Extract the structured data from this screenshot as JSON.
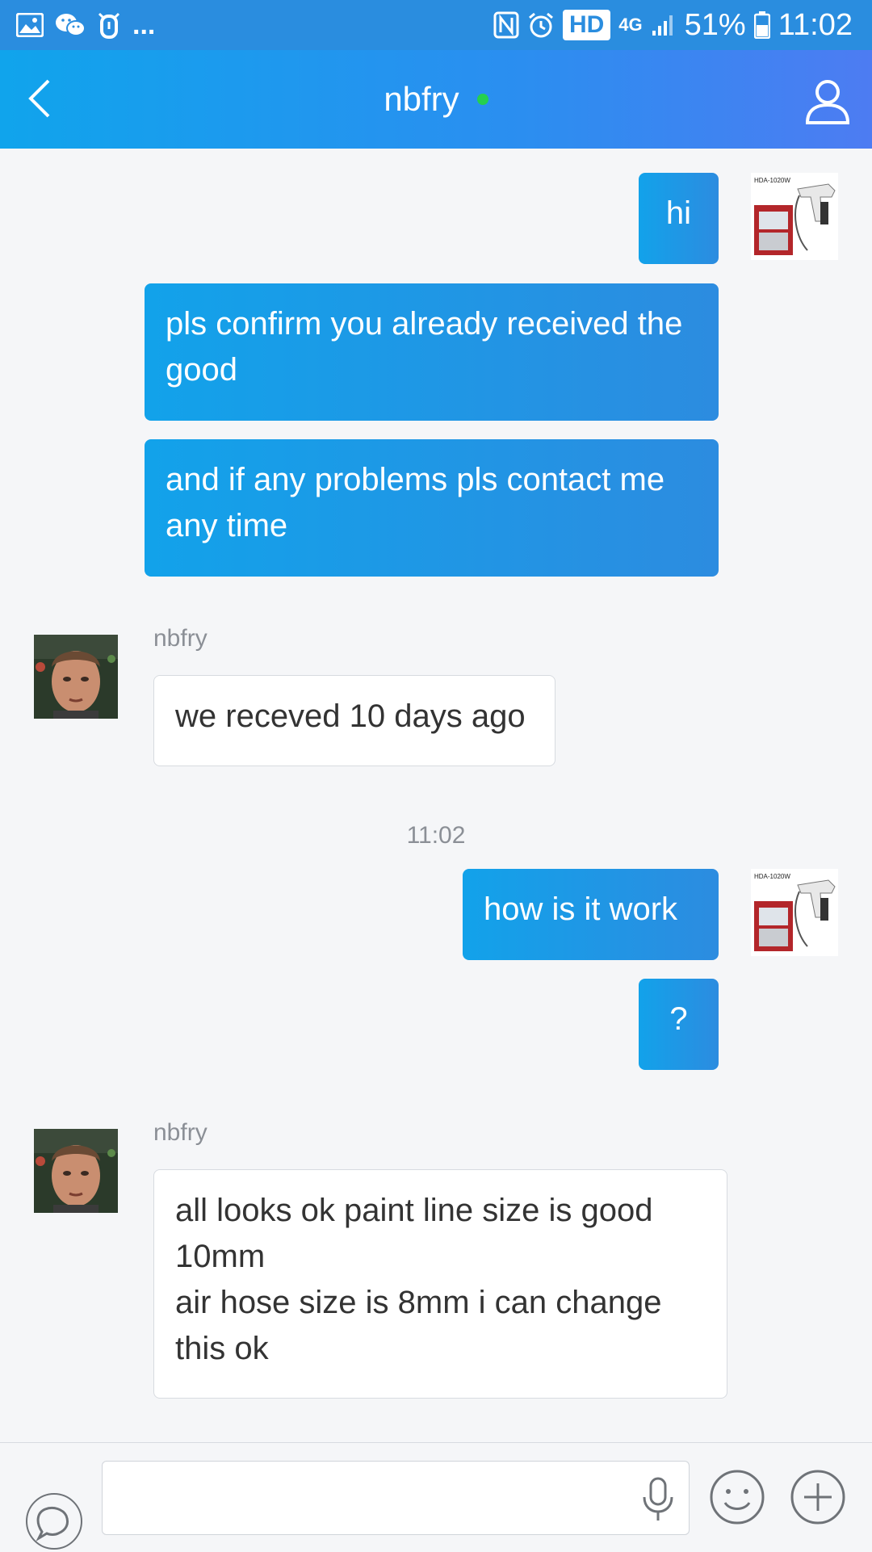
{
  "status_bar": {
    "left_icons": [
      "gallery-icon",
      "wechat-icon",
      "vibrate-icon"
    ],
    "more": "...",
    "right_icons": [
      "nfc-icon",
      "alarm-icon"
    ],
    "hd": "HD",
    "network": "4G",
    "battery": "51%",
    "time": "11:02"
  },
  "header": {
    "title": "nbfry",
    "online": true,
    "back_icon": "chevron-left-icon",
    "profile_icon": "user-icon"
  },
  "messages": {
    "m1": "hi",
    "m2": "pls confirm you already received the good",
    "m3": "and if any problems pls contact me any time",
    "m4_sender": "nbfry",
    "m4": "we receved 10 days ago",
    "time_divider": "11:02",
    "m5": "how is it work",
    "m6": "?",
    "m7_sender": "nbfry",
    "m7_line1": "all looks ok paint line size is good",
    "m7_line2": "10mm",
    "m7_line3": "air hose size is 8mm i can change",
    "m7_line4": "this ok"
  },
  "me_avatar": {
    "label": "HDA-1020W",
    "colors": {
      "cabinet": "#b3262a",
      "gun": "#e8e8e8"
    }
  },
  "input_bar": {
    "placeholder": "",
    "icons": [
      "chat-bubble-icon",
      "microphone-icon",
      "emoji-icon",
      "plus-icon"
    ]
  },
  "colors": {
    "status_bar": "#2a8ddf",
    "nav_start": "#10a4ec",
    "nav_end": "#4d7cf2",
    "outgoing_bubble": "#1b98e6",
    "online_dot": "#25d04f",
    "background": "#f5f6f8"
  }
}
